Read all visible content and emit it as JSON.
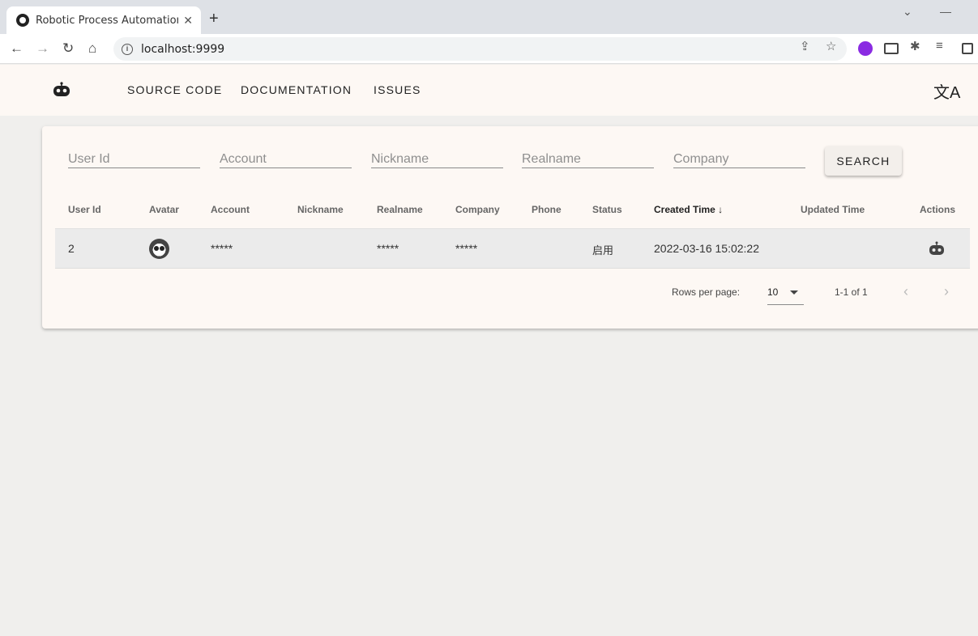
{
  "browser": {
    "tab_title": "Robotic Process Automation T",
    "new_tab": "+",
    "url": "localhost:9999"
  },
  "appbar": {
    "nav": [
      "SOURCE CODE",
      "DOCUMENTATION",
      "ISSUES"
    ]
  },
  "filters": {
    "user_id": "User Id",
    "account": "Account",
    "nickname": "Nickname",
    "realname": "Realname",
    "company": "Company",
    "search_label": "SEARCH"
  },
  "table": {
    "headers": [
      "User Id",
      "Avatar",
      "Account",
      "Nickname",
      "Realname",
      "Company",
      "Phone",
      "Status",
      "Created Time",
      "Updated Time",
      "Actions"
    ],
    "rows": [
      {
        "user_id": "2",
        "account": "*****",
        "nickname": "",
        "realname": "*****",
        "company": "*****",
        "phone": "",
        "status": "启用",
        "created_time": "2022-03-16 15:02:22",
        "updated_time": ""
      }
    ]
  },
  "pagination": {
    "rows_per_page_label": "Rows per page:",
    "rows_per_page": "10",
    "range": "1-1 of 1"
  },
  "colors": {
    "appbar_bg": "#fdf8f4",
    "page_bg": "#f0efed",
    "row_bg": "#ebebeb"
  }
}
